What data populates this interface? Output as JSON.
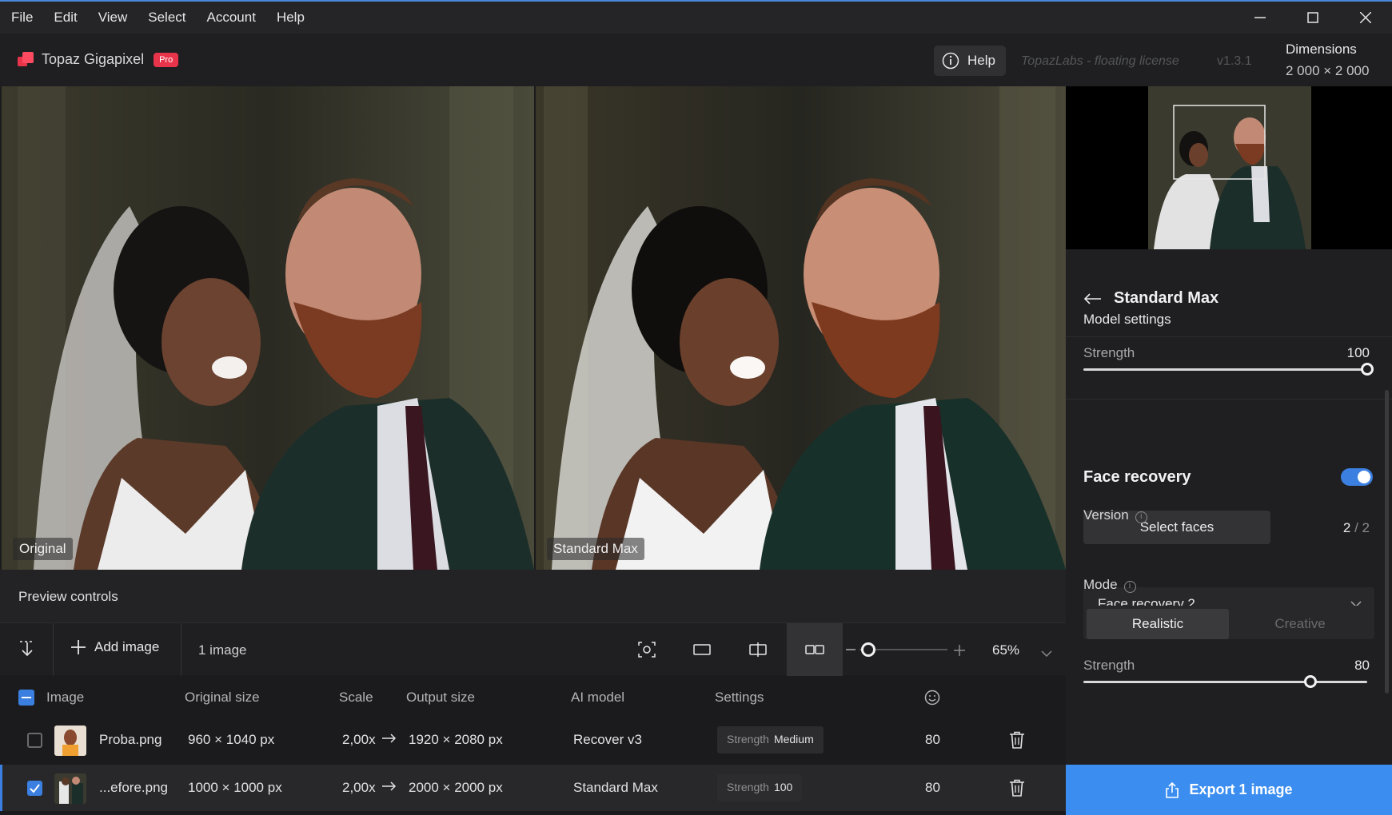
{
  "menu": [
    "File",
    "Edit",
    "View",
    "Select",
    "Account",
    "Help"
  ],
  "app": {
    "name": "Topaz Gigapixel",
    "badge": "Pro"
  },
  "header": {
    "help_label": "Help",
    "license": "TopazLabs - floating license",
    "version": "v1.3.1",
    "dimensions_label": "Dimensions",
    "dimensions_value": "2 000 × 2 000"
  },
  "previews": {
    "left_label": "Original",
    "right_label": "Standard Max"
  },
  "preview_controls": "Preview controls",
  "toolbar": {
    "add_image": "Add image",
    "count": "1 image",
    "zoom": "65%",
    "zoom_level": 0.1
  },
  "table": {
    "headers": [
      "Image",
      "Original size",
      "Scale",
      "Output size",
      "AI model",
      "Settings"
    ],
    "rows": [
      {
        "checked": false,
        "name": "Proba.png",
        "original": "960 × 1040 px",
        "scale": "2,00x",
        "output": "1920 × 2080 px",
        "model": "Recover v3",
        "setting_key": "Strength",
        "setting_val": "Medium",
        "face": "80"
      },
      {
        "checked": true,
        "name": "...efore.png",
        "original": "1000 × 1000 px",
        "scale": "2,00x",
        "output": "2000 × 2000 px",
        "model": "Standard Max",
        "setting_key": "Strength",
        "setting_val": "100",
        "face": "80"
      }
    ]
  },
  "panel": {
    "title": "Standard Max",
    "model_settings": "Model settings",
    "strength_label": "Strength",
    "strength_value": "100",
    "strength_level": 1.0,
    "face_recovery": "Face recovery",
    "face_recovery_on": true,
    "select_faces": "Select faces",
    "faces_selected": "2",
    "faces_total": "2",
    "version_label": "Version",
    "version_value": "Face recovery 2",
    "mode_label": "Mode",
    "mode_options": [
      "Realistic",
      "Creative"
    ],
    "mode_selected": "Realistic",
    "face_strength_label": "Strength",
    "face_strength_value": "80",
    "face_strength_level": 0.8,
    "export": "Export 1 image"
  },
  "colors": {
    "accent": "#3b8ef0",
    "brand": "#e8344a",
    "bg": "#1b1b1d"
  }
}
